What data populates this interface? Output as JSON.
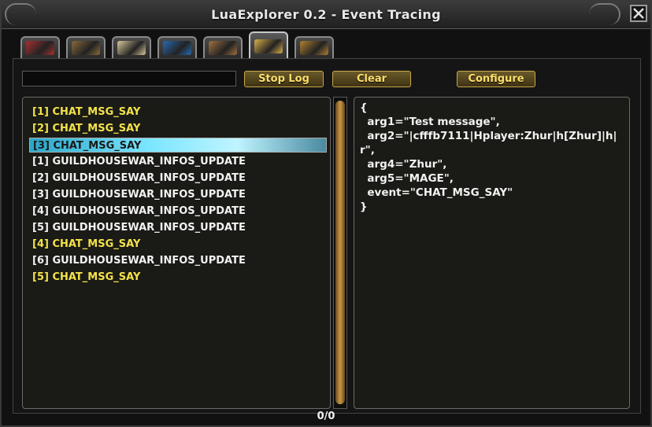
{
  "window": {
    "title": "LuaExplorer 0.2 - Event Tracing"
  },
  "tabs": [
    {
      "icon": "red-book-icon",
      "color": "#a83030"
    },
    {
      "icon": "sword-icon",
      "color": "#8a6a3a"
    },
    {
      "icon": "open-book-icon",
      "color": "#d8c89a"
    },
    {
      "icon": "blue-orb-icon",
      "color": "#2a6ab0"
    },
    {
      "icon": "tools-icon",
      "color": "#a07040"
    },
    {
      "icon": "scroll-event-icon",
      "color": "#d8b04a"
    },
    {
      "icon": "golden-emblem-icon",
      "color": "#b08030"
    }
  ],
  "active_tab_index": 5,
  "toolbar": {
    "filter_value": "",
    "stop_label": "Stop Log",
    "clear_label": "Clear",
    "configure_label": "Configure"
  },
  "events": [
    {
      "label": "[1] CHAT_MSG_SAY",
      "color": "yellow"
    },
    {
      "label": "[2] CHAT_MSG_SAY",
      "color": "yellow"
    },
    {
      "label": "[3] CHAT_MSG_SAY",
      "color": "yellow",
      "selected": true
    },
    {
      "label": "[1] GUILDHOUSEWAR_INFOS_UPDATE",
      "color": "white"
    },
    {
      "label": "[2] GUILDHOUSEWAR_INFOS_UPDATE",
      "color": "white"
    },
    {
      "label": "[3] GUILDHOUSEWAR_INFOS_UPDATE",
      "color": "white"
    },
    {
      "label": "[4] GUILDHOUSEWAR_INFOS_UPDATE",
      "color": "white"
    },
    {
      "label": "[5] GUILDHOUSEWAR_INFOS_UPDATE",
      "color": "white"
    },
    {
      "label": "[4] CHAT_MSG_SAY",
      "color": "yellow"
    },
    {
      "label": "[6] GUILDHOUSEWAR_INFOS_UPDATE",
      "color": "white"
    },
    {
      "label": "[5] CHAT_MSG_SAY",
      "color": "yellow"
    }
  ],
  "detail": {
    "text": "{\n  arg1=\"Test message\",\n  arg2=\"|cfffb7111|Hplayer:Zhur|h[Zhur]|h|r\",\n  arg4=\"Zhur\",\n  arg5=\"MAGE\",\n  event=\"CHAT_MSG_SAY\"\n}"
  },
  "status": {
    "page_label": "0/0"
  }
}
